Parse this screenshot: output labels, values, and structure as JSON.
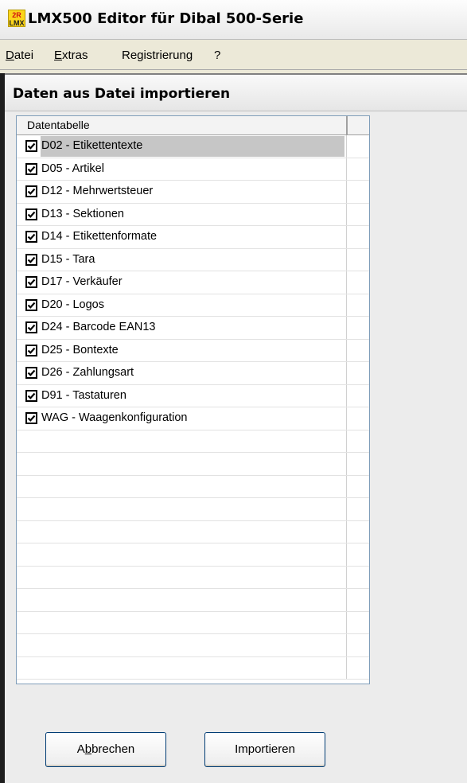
{
  "window": {
    "title": "LMX500 Editor für Dibal 500-Serie",
    "icon_text_top": "2R",
    "icon_text_bottom": "LMX"
  },
  "menubar": {
    "items": [
      {
        "label": "Datei",
        "mnemonic": "D"
      },
      {
        "label": "Extras",
        "mnemonic": "E"
      },
      {
        "label": "Registrierung"
      },
      {
        "label": "?"
      }
    ]
  },
  "dialog": {
    "title": "Daten aus Datei importieren"
  },
  "table": {
    "column_header": "Datentabelle",
    "rows": [
      {
        "label": "D02 - Etikettentexte",
        "checked": true,
        "selected": true
      },
      {
        "label": "D05 - Artikel",
        "checked": true
      },
      {
        "label": "D12 - Mehrwertsteuer",
        "checked": true
      },
      {
        "label": "D13 - Sektionen",
        "checked": true
      },
      {
        "label": "D14 - Etikettenformate",
        "checked": true
      },
      {
        "label": "D15 - Tara",
        "checked": true
      },
      {
        "label": "D17 - Verkäufer",
        "checked": true
      },
      {
        "label": "D20 - Logos",
        "checked": true
      },
      {
        "label": "D24 - Barcode EAN13",
        "checked": true
      },
      {
        "label": "D25 - Bontexte",
        "checked": true
      },
      {
        "label": "D26 - Zahlungsart",
        "checked": true
      },
      {
        "label": "D91 - Tastaturen",
        "checked": true
      },
      {
        "label": "WAG - Waagenkonfiguration",
        "checked": true
      }
    ]
  },
  "buttons": {
    "cancel": "Abbrechen",
    "import": "Importieren"
  }
}
